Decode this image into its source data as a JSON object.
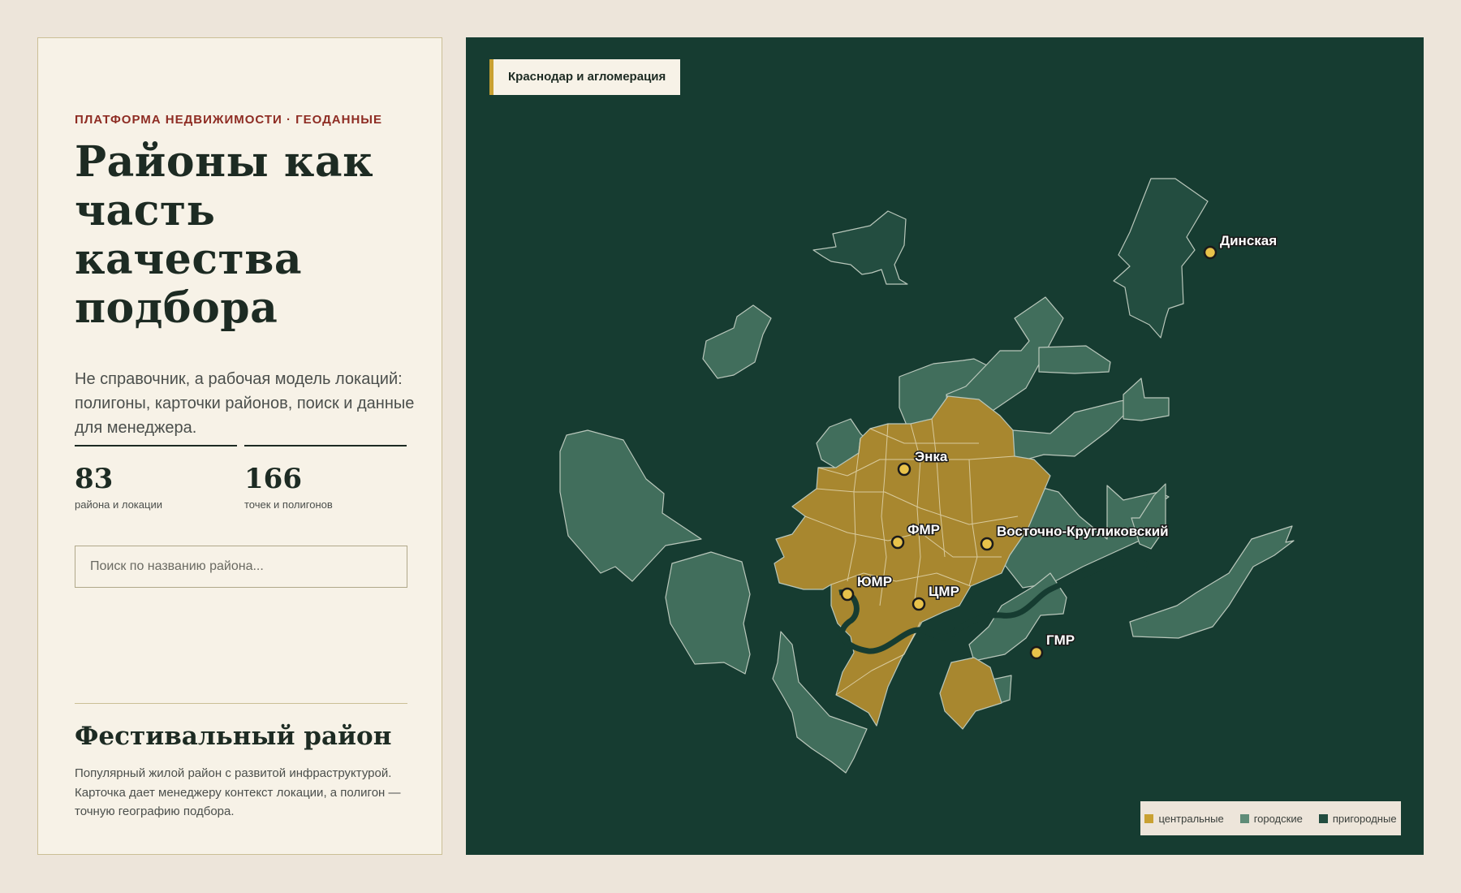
{
  "sidebar": {
    "eyebrow": "ПЛАТФОРМА НЕДВИЖИМОСТИ · ГЕОДАННЫЕ",
    "title": "Районы как часть качества подбора",
    "lead": "Не справочник, а рабочая модель локаций: полигоны, карточки районов, поиск и данные для менеджера.",
    "stats": [
      {
        "value": "83",
        "caption": "района и локации"
      },
      {
        "value": "166",
        "caption": "точек и полигонов"
      }
    ],
    "search": {
      "placeholder": "Поиск по названию района...",
      "value": ""
    },
    "district": {
      "title": "Фестивальный район",
      "description": "Популярный жилой район с развитой инфраструктурой. Карточка дает менеджеру контекст локации, а полигон — точную географию подбора."
    }
  },
  "map": {
    "tag": "Краснодар и агломерация",
    "colors": {
      "central": "#a8872f",
      "urban": "#416e5c",
      "suburban": "#234d40",
      "water": "#163c31",
      "background": "#163c31",
      "pin": "#e8c24a"
    },
    "pins": [
      {
        "label": "Динская"
      },
      {
        "label": "Энка"
      },
      {
        "label": "ФМР"
      },
      {
        "label": "Восточно-Кругликовский"
      },
      {
        "label": "ЮМР"
      },
      {
        "label": "ЦМР"
      },
      {
        "label": "ГМР"
      }
    ],
    "legend": [
      {
        "label": "центральные",
        "color": "#c9a132"
      },
      {
        "label": "городские",
        "color": "#5f8c78"
      },
      {
        "label": "пригородные",
        "color": "#234d40"
      }
    ]
  }
}
